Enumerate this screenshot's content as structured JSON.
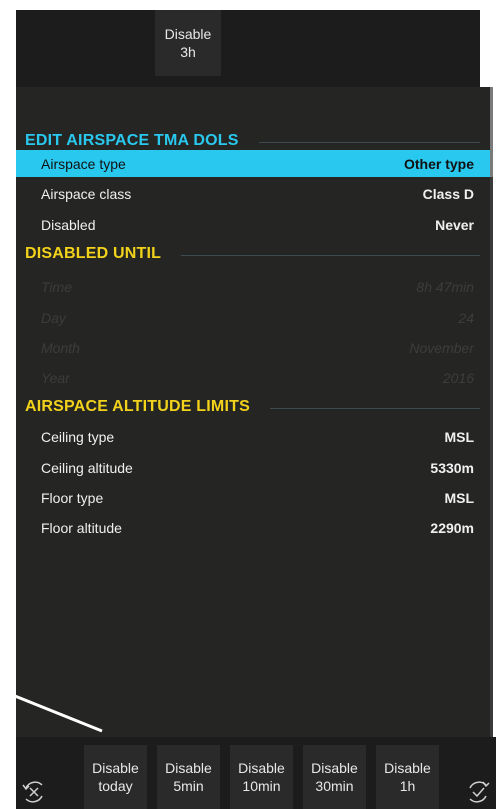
{
  "top_toolbar": {
    "disable_3h": {
      "line1": "Disable",
      "line2": "3h"
    }
  },
  "sections": {
    "edit_title": "EDIT AIRSPACE TMA DOLS",
    "disabled_until_title": "DISABLED UNTIL",
    "altitude_title": "AIRSPACE ALTITUDE LIMITS"
  },
  "edit_rows": [
    {
      "label": "Airspace type",
      "value": "Other type"
    },
    {
      "label": "Airspace class",
      "value": "Class D"
    },
    {
      "label": "Disabled",
      "value": "Never"
    }
  ],
  "until_rows": [
    {
      "label": "Time",
      "value": "8h 47min"
    },
    {
      "label": "Day",
      "value": "24"
    },
    {
      "label": "Month",
      "value": "November"
    },
    {
      "label": "Year",
      "value": "2016"
    }
  ],
  "altitude_rows": [
    {
      "label": "Ceiling type",
      "value": "MSL"
    },
    {
      "label": "Ceiling altitude",
      "value": "5330m"
    },
    {
      "label": "Floor type",
      "value": "MSL"
    },
    {
      "label": "Floor altitude",
      "value": "2290m"
    }
  ],
  "bottom_toolbar": [
    {
      "line1": "Disable",
      "line2": "today"
    },
    {
      "line1": "Disable",
      "line2": "5min"
    },
    {
      "line1": "Disable",
      "line2": "10min"
    },
    {
      "line1": "Disable",
      "line2": "30min"
    },
    {
      "line1": "Disable",
      "line2": "1h"
    }
  ],
  "icons": {
    "left": "rotate-cancel-icon",
    "right": "rotate-confirm-icon"
  },
  "colors": {
    "section_edit": "#29c8ef",
    "section_yellow": "#f2d21b",
    "selected_row": "#29c8ef",
    "panel": "#252624"
  }
}
